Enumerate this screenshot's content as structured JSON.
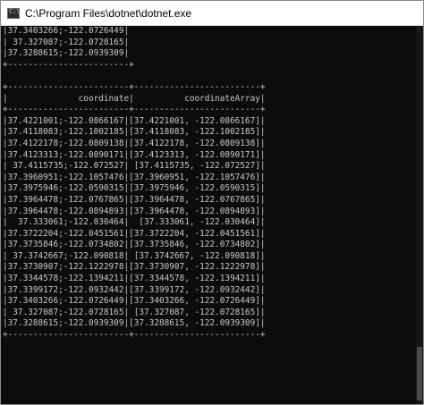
{
  "window": {
    "title": "C:\\Program Files\\dotnet\\dotnet.exe",
    "icon": "console-app-icon"
  },
  "console": {
    "lines": [
      "|37.3403266;-122.0726449|",
      "| 37.327087;-122.0728165|",
      "|37.3288615;-122.0939309|",
      "+------------------------+",
      "",
      "+------------------------+-------------------------+",
      "|              coordinate|          coordinateArray|",
      "+------------------------+-------------------------+",
      "|37.4221001;-122.0866167|[37.4221001, -122.0866167]|",
      "|37.4118083;-122.1002185|[37.4118083, -122.1002185]|",
      "|37.4122178;-122.0809138|[37.4122178, -122.0809138]|",
      "|37.4123313;-122.0890171|[37.4123313, -122.0890171]|",
      "| 37.4115735;-122.072527| [37.4115735, -122.072527]|",
      "|37.3960951;-122.1057476|[37.3960951, -122.1057476]|",
      "|37.3975946;-122.0590315|[37.3975946, -122.0590315]|",
      "|37.3964478;-122.0767865|[37.3964478, -122.0767865]|",
      "|37.3964478;-122.0894893|[37.3964478, -122.0894893]|",
      "|  37.333061;-122.030464|  [37.333061, -122.030464]|",
      "|37.3722204;-122.0451561|[37.3722204, -122.0451561]|",
      "|37.3735846;-122.0734802|[37.3735846, -122.0734802]|",
      "| 37.3742667;-122.090818| [37.3742667, -122.090818]|",
      "|37.3730907;-122.1222978|[37.3730907, -122.1222978]|",
      "|37.3344578;-122.1394211|[37.3344578, -122.1394211]|",
      "|37.3399172;-122.0932442|[37.3399172, -122.0932442]|",
      "|37.3403266;-122.0726449|[37.3403266, -122.0726449]|",
      "| 37.327087;-122.0728165| [37.327087, -122.0728165]|",
      "|37.3288615;-122.0939309|[37.3288615, -122.0939309]|",
      "+------------------------+-------------------------+"
    ]
  },
  "colors": {
    "console_background": "#0c0c0c",
    "console_text": "#c8c8c8",
    "titlebar_background": "#ffffff"
  }
}
